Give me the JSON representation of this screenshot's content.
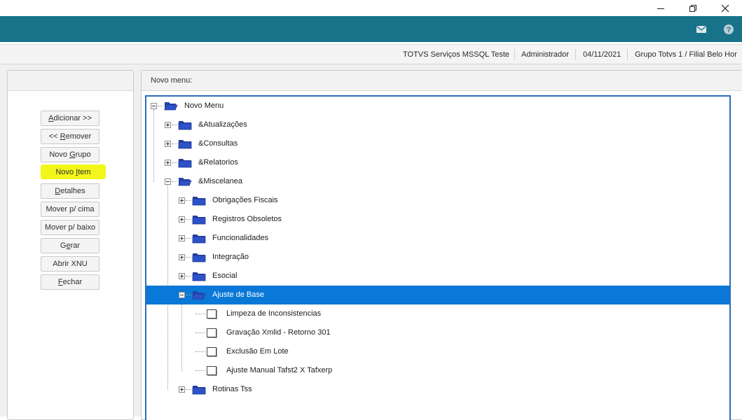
{
  "window": {
    "min_icon": "minimize-icon",
    "restore_icon": "restore-icon",
    "close_icon": "close-icon"
  },
  "header": {
    "bg_color": "#18728a",
    "mail_icon": "mail-icon",
    "help_icon": "help-icon"
  },
  "info": {
    "server": "TOTVS Serviços MSSQL Teste",
    "user": "Administrador",
    "date": "04/11/2021",
    "branch": "Grupo Totvs 1 / Filial Belo Hor"
  },
  "actions": [
    {
      "label": "Adicionar >>",
      "accel": "A"
    },
    {
      "label": "<< Remover",
      "accel": "R"
    },
    {
      "label": "Novo Grupo",
      "accel": "G"
    },
    {
      "label": "Novo Item",
      "accel": "I",
      "highlighted": true
    },
    {
      "label": "Detalhes",
      "accel": "D"
    },
    {
      "label": "Mover p/ cima",
      "accel": ""
    },
    {
      "label": "Mover p/ baixo",
      "accel": ""
    },
    {
      "label": "Gerar",
      "accel": "e"
    },
    {
      "label": "Abrir XNU",
      "accel": ""
    },
    {
      "label": "Fechar",
      "accel": "F"
    }
  ],
  "menu_panel": {
    "title": "Novo menu:",
    "tree": [
      {
        "label": "Novo Menu",
        "level": 0,
        "type": "folder-open",
        "expander": "minus"
      },
      {
        "label": "&Atualizações",
        "level": 1,
        "type": "folder",
        "expander": "plus"
      },
      {
        "label": "&Consultas",
        "level": 1,
        "type": "folder",
        "expander": "plus"
      },
      {
        "label": "&Relatorios",
        "level": 1,
        "type": "folder",
        "expander": "plus"
      },
      {
        "label": "&Miscelanea",
        "level": 1,
        "type": "folder-open",
        "expander": "minus"
      },
      {
        "label": "Obrigações Fiscais",
        "level": 2,
        "type": "folder",
        "expander": "plus"
      },
      {
        "label": "Registros Obsoletos",
        "level": 2,
        "type": "folder",
        "expander": "plus"
      },
      {
        "label": "Funcionalidades",
        "level": 2,
        "type": "folder",
        "expander": "plus"
      },
      {
        "label": "Integração",
        "level": 2,
        "type": "folder",
        "expander": "plus"
      },
      {
        "label": "Esocial",
        "level": 2,
        "type": "folder",
        "expander": "plus"
      },
      {
        "label": "Ajuste de Base",
        "level": 2,
        "type": "folder-open",
        "expander": "minus",
        "selected": true
      },
      {
        "label": "Limpeza de Inconsistencias",
        "level": 3,
        "type": "item"
      },
      {
        "label": "Gravação Xmlid - Retorno 301",
        "level": 3,
        "type": "item"
      },
      {
        "label": "Exclusão Em Lote",
        "level": 3,
        "type": "item"
      },
      {
        "label": "Ajuste Manual Tafst2 X Tafxerp",
        "level": 3,
        "type": "item"
      },
      {
        "label": "Rotinas Tss",
        "level": 2,
        "type": "folder",
        "expander": "plus"
      }
    ]
  },
  "colors": {
    "selection": "#0a78d7",
    "highlight": "#f2f61a",
    "folder": "#2d52c7"
  }
}
